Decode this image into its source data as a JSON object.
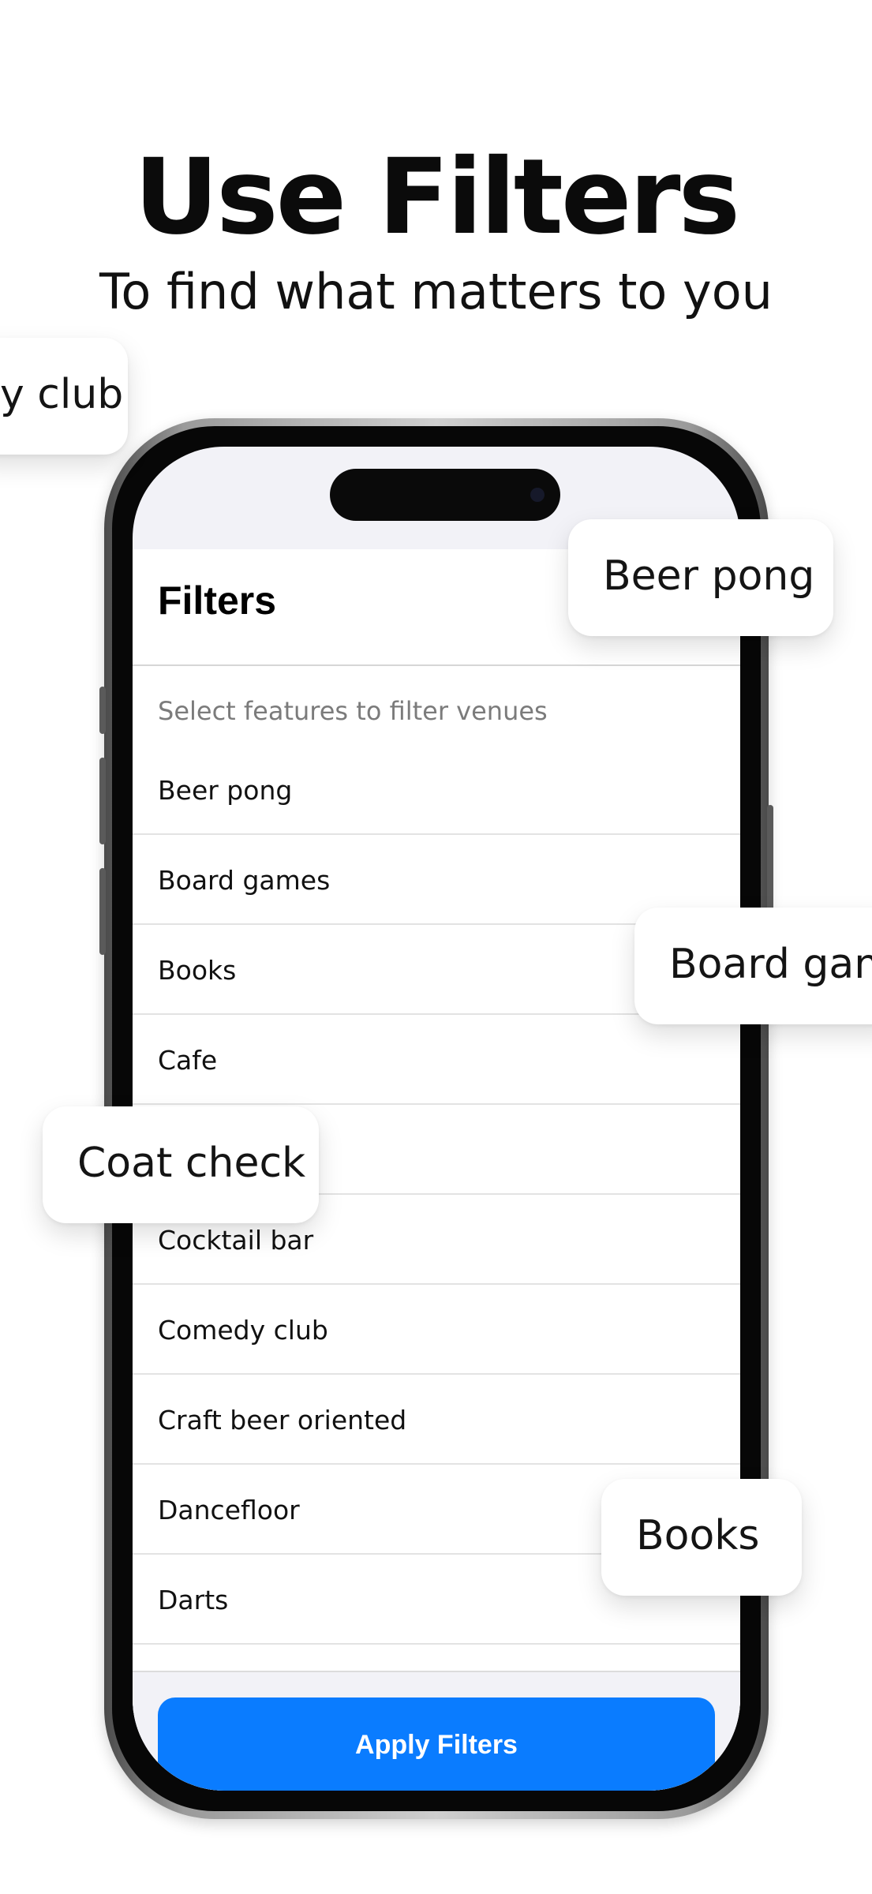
{
  "headline": "Use Filters",
  "subheadline": "To find what matters to you",
  "filters_sheet": {
    "title": "Filters",
    "hint": "Select features to filter venues",
    "items": [
      "Beer pong",
      "Board games",
      "Books",
      "Cafe",
      "",
      "Cocktail bar",
      "Comedy club",
      "Craft beer oriented",
      "Dancefloor",
      "Darts"
    ],
    "apply_label": "Apply Filters",
    "accent_color": "#0a7cff"
  },
  "floating_chips": [
    "y club",
    "Beer pong",
    "Board gam",
    "Coat check",
    "Books"
  ]
}
